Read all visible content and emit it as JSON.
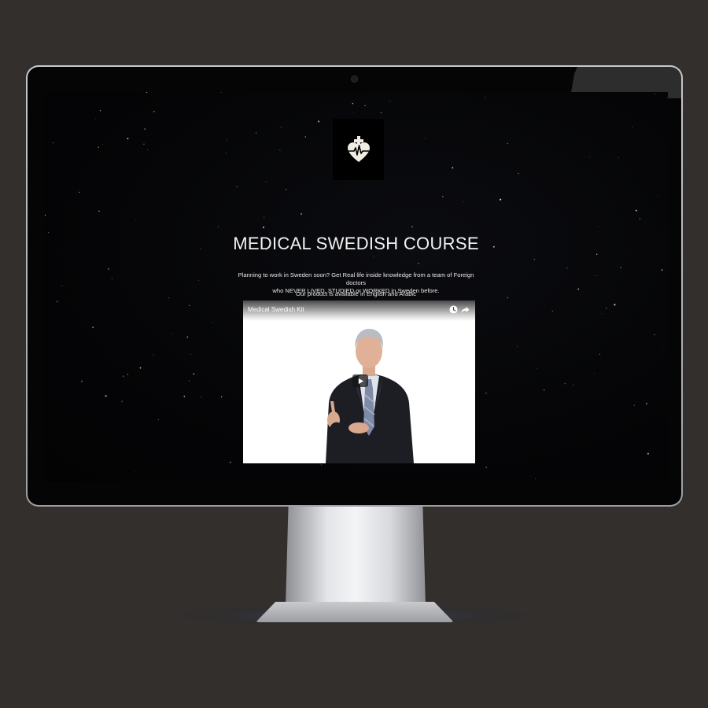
{
  "page": {
    "title": "MEDICAL SWEDISH COURSE",
    "intro_line1": "Planning to work in Sweden soon? Get Real life inside knowledge from a team of Foreign doctors",
    "intro_line2": "who NEVER LIVED, STUDIED or WORKED in Sweden before.",
    "availability": "Our product is available in English and Arabic"
  },
  "logo": {
    "icon": "heart-cross-ecg-icon",
    "color": "#f0ebe3"
  },
  "video": {
    "title": "Medical Swedish Kit",
    "icons": [
      "watch-later-icon",
      "share-icon",
      "play-icon"
    ]
  },
  "colors": {
    "backdrop": "#332f2d",
    "screen_background": "#050507",
    "text": "#f2f2f2"
  }
}
